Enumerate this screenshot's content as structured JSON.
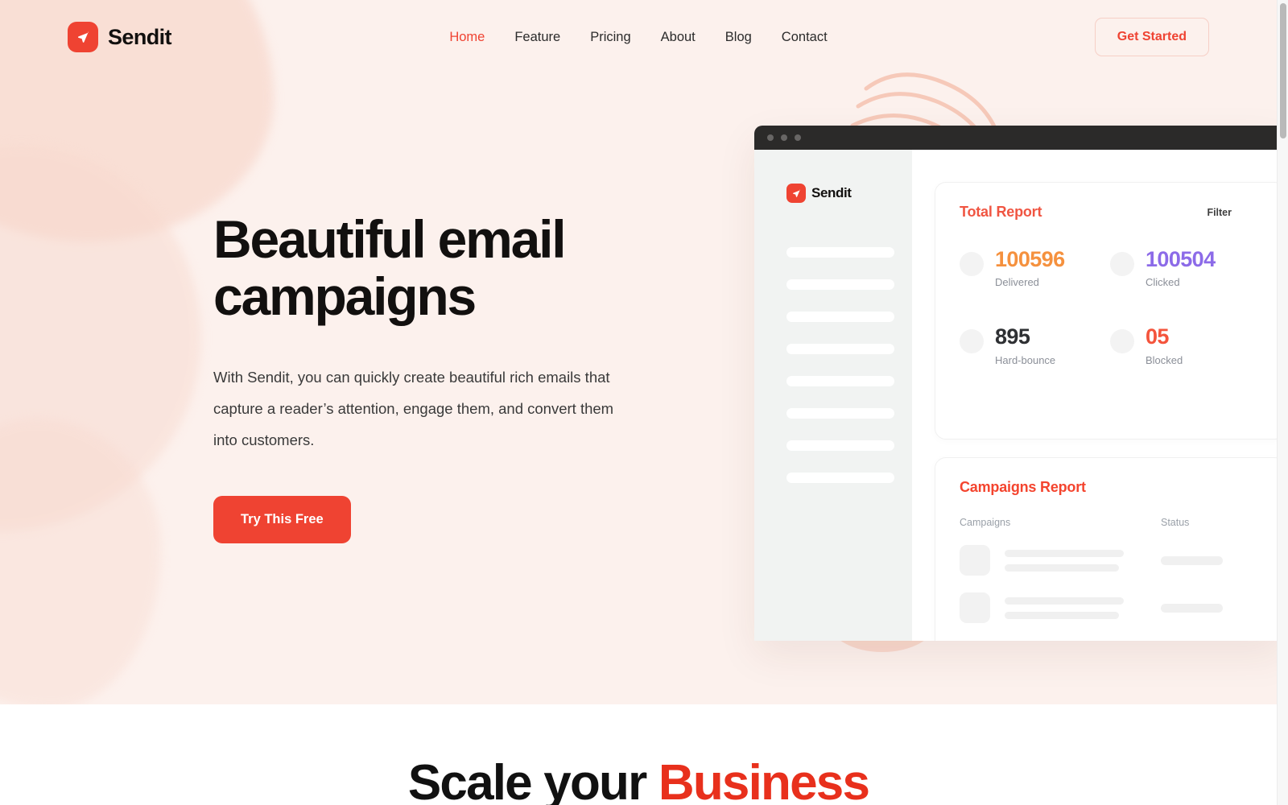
{
  "brand": {
    "name": "Sendit",
    "logo_icon": "paper-plane-icon",
    "accent": "#ef4332"
  },
  "header": {
    "nav": [
      {
        "label": "Home",
        "active": true
      },
      {
        "label": "Feature",
        "active": false
      },
      {
        "label": "Pricing",
        "active": false
      },
      {
        "label": "About",
        "active": false
      },
      {
        "label": "Blog",
        "active": false
      },
      {
        "label": "Contact",
        "active": false
      }
    ],
    "cta_label": "Get Started"
  },
  "hero": {
    "headline": "Beautiful email campaigns",
    "subtitle": "With Sendit, you can quickly create beautiful rich emails that capture a reader’s attention, engage them, and convert them into customers.",
    "cta_label": "Try This Free",
    "background": "#fcf1ed"
  },
  "dashboard": {
    "titlebar_dots": 3,
    "sidebar": {
      "logo_text": "Sendit",
      "placeholder_bar_count": 8
    },
    "total_report": {
      "title": "Total Report",
      "filter_label": "Filter",
      "stats": [
        {
          "value": "100596",
          "label": "Delivered",
          "color": "#f5913e"
        },
        {
          "value": "100504",
          "label": "Clicked",
          "color": "#8c6be8"
        },
        {
          "value": "895",
          "label": "Hard-bounce",
          "color": "#2e3033"
        },
        {
          "value": "05",
          "label": "Blocked",
          "color": "#f4543c"
        }
      ]
    },
    "campaigns_report": {
      "title": "Campaigns Report",
      "columns": [
        "Campaigns",
        "Status"
      ],
      "row_count": 2
    }
  },
  "lower_section": {
    "title_plain": "Scale your ",
    "title_accent": "Business",
    "accent_color": "#e8301c"
  }
}
